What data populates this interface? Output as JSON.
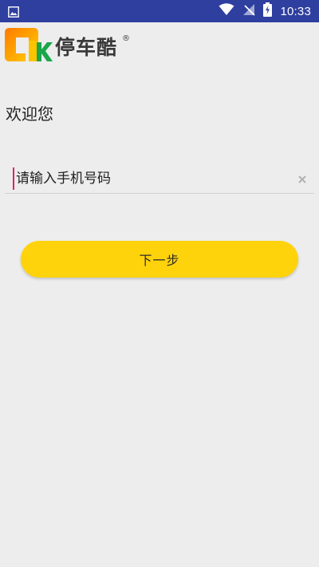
{
  "status_bar": {
    "left_icon": "image-icon",
    "icons": [
      "wifi-icon",
      "signal-off-icon",
      "battery-charging-icon"
    ],
    "time": "10:33",
    "background": "#2e3f9f"
  },
  "app": {
    "logo": {
      "text": "停车酷",
      "registered_mark": "®",
      "mark_colors": [
        "#ff8a00",
        "#ffd000",
        "#1aa64a"
      ]
    },
    "welcome_text": "欢迎您",
    "phone_input": {
      "placeholder": "请输入手机号码",
      "value": ""
    },
    "clear_icon": "close-icon",
    "next_button": {
      "label": "下一步",
      "color": "#ffd30c"
    }
  }
}
